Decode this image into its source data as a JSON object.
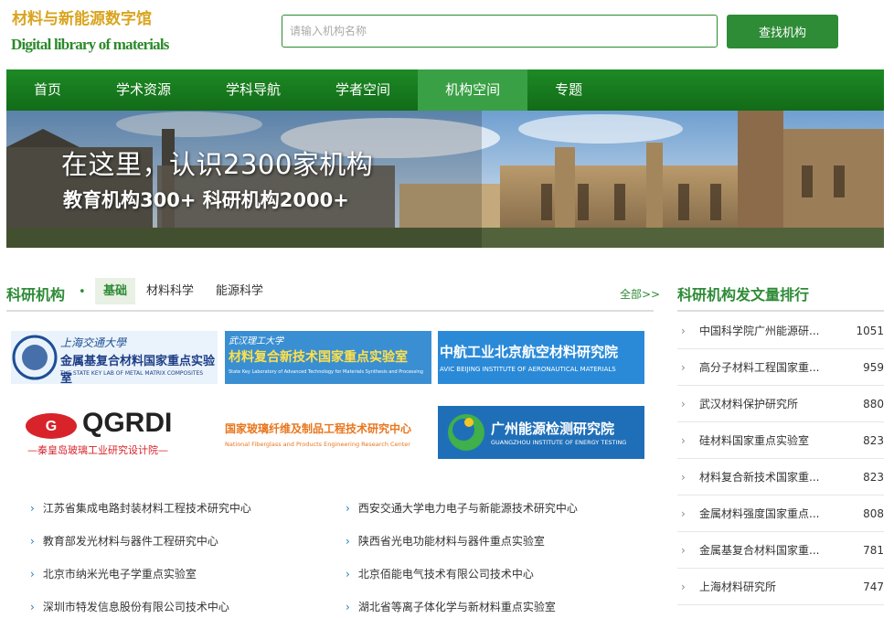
{
  "header": {
    "logo_cn": "材料与新能源数字馆",
    "logo_en": "Digital library of materials",
    "search_placeholder": "请输入机构名称",
    "search_button": "查找机构"
  },
  "nav": {
    "items": [
      "首页",
      "学术资源",
      "学科导航",
      "学者空间",
      "机构空间",
      "专题"
    ],
    "active": "机构空间"
  },
  "banner": {
    "title": "在这里，认识2300家机构",
    "subtitle": "教育机构300+ 科研机构2000+"
  },
  "research": {
    "title": "科研机构",
    "dot": "•",
    "tabs": [
      "基础",
      "材料科学",
      "能源科学"
    ],
    "active_tab": "基础",
    "more": "全部>>",
    "logos": [
      {
        "line1": "上海交通大學",
        "line2": "金属基复合材料国家重点实验室",
        "line3": "THE STATE KEY LAB OF METAL MATRIX COMPOSITES"
      },
      {
        "line1": "武汉理工大学",
        "line2": "材料复合新技术国家重点实验室",
        "line3": "State Key Laboratory of Advanced Technology for Materials Synthesis and Processing"
      },
      {
        "line1": "中航工业北京航空材料研究院",
        "line2": "AVIC BEIJING INSTITUTE OF AERONAUTICAL MATERIALS"
      },
      {
        "line1": "QGRDI",
        "line2": "—秦皇岛玻璃工业研究设计院—"
      },
      {
        "line1": "国家玻璃纤维及制品工程技术研究中心",
        "line2": "National Fiberglass and Products Engineering Research Center"
      },
      {
        "line1": "广州能源检测研究院",
        "line2": "GUANGZHOU INSTITUTE OF ENERGY TESTING"
      }
    ],
    "links_left": [
      "江苏省集成电路封装材料工程技术研究中心",
      "教育部发光材料与器件工程研究中心",
      "北京市纳米光电子学重点实验室",
      "深圳市特发信息股份有限公司技术中心"
    ],
    "links_right": [
      "西安交通大学电力电子与新能源技术研究中心",
      "陕西省光电功能材料与器件重点实验室",
      "北京佰能电气技术有限公司技术中心",
      "湖北省等离子体化学与新材料重点实验室"
    ]
  },
  "ranking": {
    "title": "科研机构发文量排行",
    "rows": [
      {
        "name": "中国科学院广州能源研...",
        "count": "1051"
      },
      {
        "name": "高分子材料工程国家重...",
        "count": "959"
      },
      {
        "name": "武汉材料保护研究所",
        "count": "880"
      },
      {
        "name": "硅材料国家重点实验室",
        "count": "823"
      },
      {
        "name": "材料复合新技术国家重...",
        "count": "823"
      },
      {
        "name": "金属材料强度国家重点...",
        "count": "808"
      },
      {
        "name": "金属基复合材料国家重...",
        "count": "781"
      },
      {
        "name": "上海材料研究所",
        "count": "747"
      }
    ]
  },
  "colors": {
    "brand_green": "#2e8b36",
    "nav_active": "#3aa045",
    "logo_gold": "#d9a41f",
    "link_chevron": "#1c7fc0"
  }
}
